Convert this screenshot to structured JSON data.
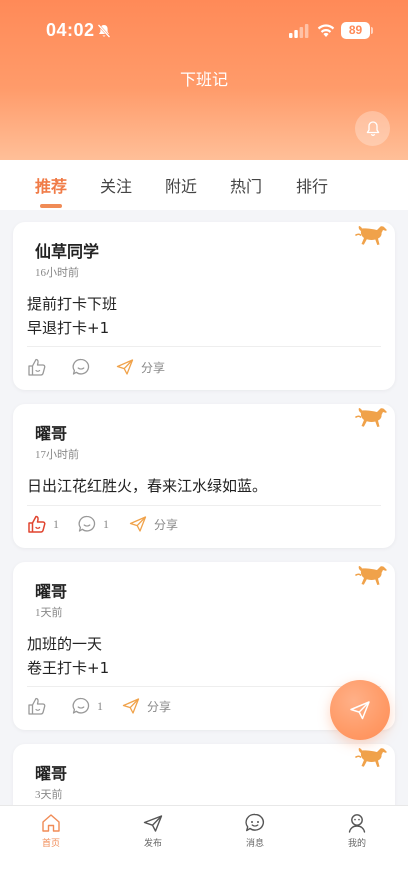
{
  "status_bar": {
    "time": "04:02",
    "battery": "89"
  },
  "header": {
    "title": "下班记"
  },
  "tabs": [
    {
      "label": "推荐",
      "active": true
    },
    {
      "label": "关注",
      "active": false
    },
    {
      "label": "附近",
      "active": false
    },
    {
      "label": "热门",
      "active": false
    },
    {
      "label": "排行",
      "active": false
    }
  ],
  "posts": [
    {
      "author": "仙草同学",
      "time": "16小时前",
      "lines": [
        "提前打卡下班",
        "早退打卡+1"
      ],
      "likes": "",
      "comments": "",
      "share": "分享",
      "liked": false
    },
    {
      "author": "曜哥",
      "time": "17小时前",
      "lines": [
        "日出江花红胜火，春来江水绿如蓝。"
      ],
      "likes": "1",
      "comments": "1",
      "share": "分享",
      "liked": true
    },
    {
      "author": "曜哥",
      "time": "1天前",
      "lines": [
        "加班的一天",
        "卷王打卡+1"
      ],
      "likes": "",
      "comments": "1",
      "share": "分享",
      "liked": false
    },
    {
      "author": "曜哥",
      "time": "3天前",
      "lines": [],
      "likes": "",
      "comments": "",
      "share": "",
      "liked": false
    }
  ],
  "bottom_nav": [
    {
      "label": "首页",
      "icon": "home-icon",
      "active": true
    },
    {
      "label": "发布",
      "icon": "send-icon",
      "active": false
    },
    {
      "label": "消息",
      "icon": "message-icon",
      "active": false
    },
    {
      "label": "我的",
      "icon": "profile-icon",
      "active": false
    }
  ],
  "colors": {
    "accent": "#f08b56",
    "header_top": "#ff8a58",
    "liked": "#e0442f"
  }
}
